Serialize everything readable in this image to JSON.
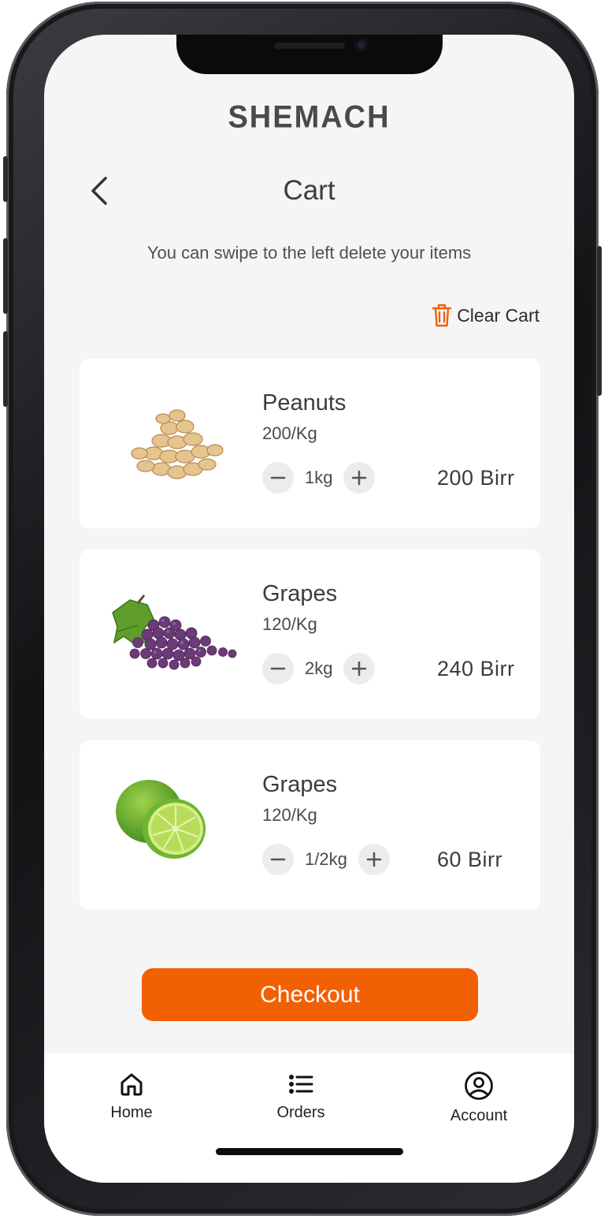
{
  "app": {
    "brand": "SHEMACH"
  },
  "header": {
    "title": "Cart",
    "back_icon": "chevron-left-icon"
  },
  "hint": "You can swipe to the left delete your items",
  "clear_cart": {
    "label": "Clear Cart",
    "icon": "trash-icon",
    "icon_color": "#f26004"
  },
  "cart_items": [
    {
      "name": "Peanuts",
      "unit_price": "200/Kg",
      "quantity": "1kg",
      "total": "200 Birr",
      "image": "peanuts-image"
    },
    {
      "name": "Grapes",
      "unit_price": "120/Kg",
      "quantity": "2kg",
      "total": "240 Birr",
      "image": "grapes-image"
    },
    {
      "name": "Grapes",
      "unit_price": "120/Kg",
      "quantity": "1/2kg",
      "total": "60 Birr",
      "image": "lime-image"
    }
  ],
  "checkout": {
    "label": "Checkout",
    "color": "#f26004"
  },
  "bottom_nav": [
    {
      "label": "Home",
      "icon": "home-icon"
    },
    {
      "label": "Orders",
      "icon": "list-icon"
    },
    {
      "label": "Account",
      "icon": "user-circle-icon"
    }
  ]
}
